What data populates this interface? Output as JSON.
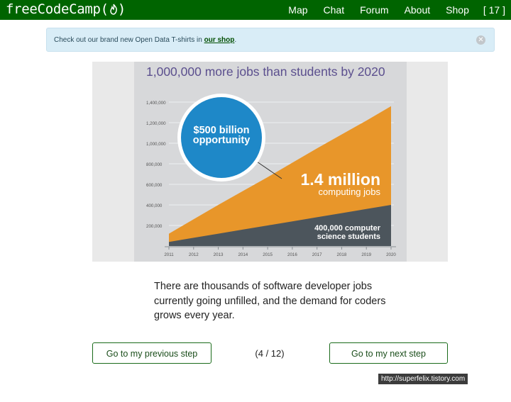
{
  "navbar": {
    "brand": "freeCodeCamp(",
    "brand_close": ")",
    "flame_icon": "flame-icon",
    "links": [
      "Map",
      "Chat",
      "Forum",
      "About",
      "Shop"
    ],
    "points": "[ 17 ]"
  },
  "alert": {
    "message": "Check out our brand new Open Data T-shirts in",
    "link": "our shop",
    "suffix": ".",
    "close_icon": "close-icon"
  },
  "infographic": {
    "title": "1,000,000 more jobs than students by 2020",
    "bubble_line1": "$500 billion",
    "bubble_line2": "opportunity",
    "jobs_line1": "1.4 million",
    "jobs_line2": "computing jobs",
    "students_line1": "400,000 computer",
    "students_line2": "science students",
    "colors": {
      "jobs": "#e8962a",
      "students": "#4c555c",
      "bubble": "#1e88c8",
      "title": "#5b4f8e"
    }
  },
  "chart_data": {
    "type": "area",
    "x": [
      2011,
      2012,
      2013,
      2014,
      2015,
      2016,
      2017,
      2018,
      2019,
      2020
    ],
    "series": [
      {
        "name": "computing jobs",
        "values": [
          120000,
          260000,
          400000,
          535000,
          670000,
          810000,
          950000,
          1085000,
          1220000,
          1360000
        ]
      },
      {
        "name": "computer science students",
        "values": [
          40000,
          80000,
          120000,
          160000,
          200000,
          240000,
          280000,
          320000,
          360000,
          400000
        ]
      }
    ],
    "yticks": [
      "200,000",
      "400,000",
      "600,000",
      "800,000",
      "1,000,000",
      "1,200,000",
      "1,400,000"
    ],
    "ylim": [
      0,
      1400000
    ],
    "grid": true
  },
  "content": {
    "lead": "There are thousands of software developer jobs currently going unfilled, and the demand for coders grows every year."
  },
  "nav_buttons": {
    "prev": "Go to my previous step",
    "counter": "(4 / 12)",
    "next": "Go to my next step"
  },
  "watermark": "http://superfelix.tistory.com"
}
